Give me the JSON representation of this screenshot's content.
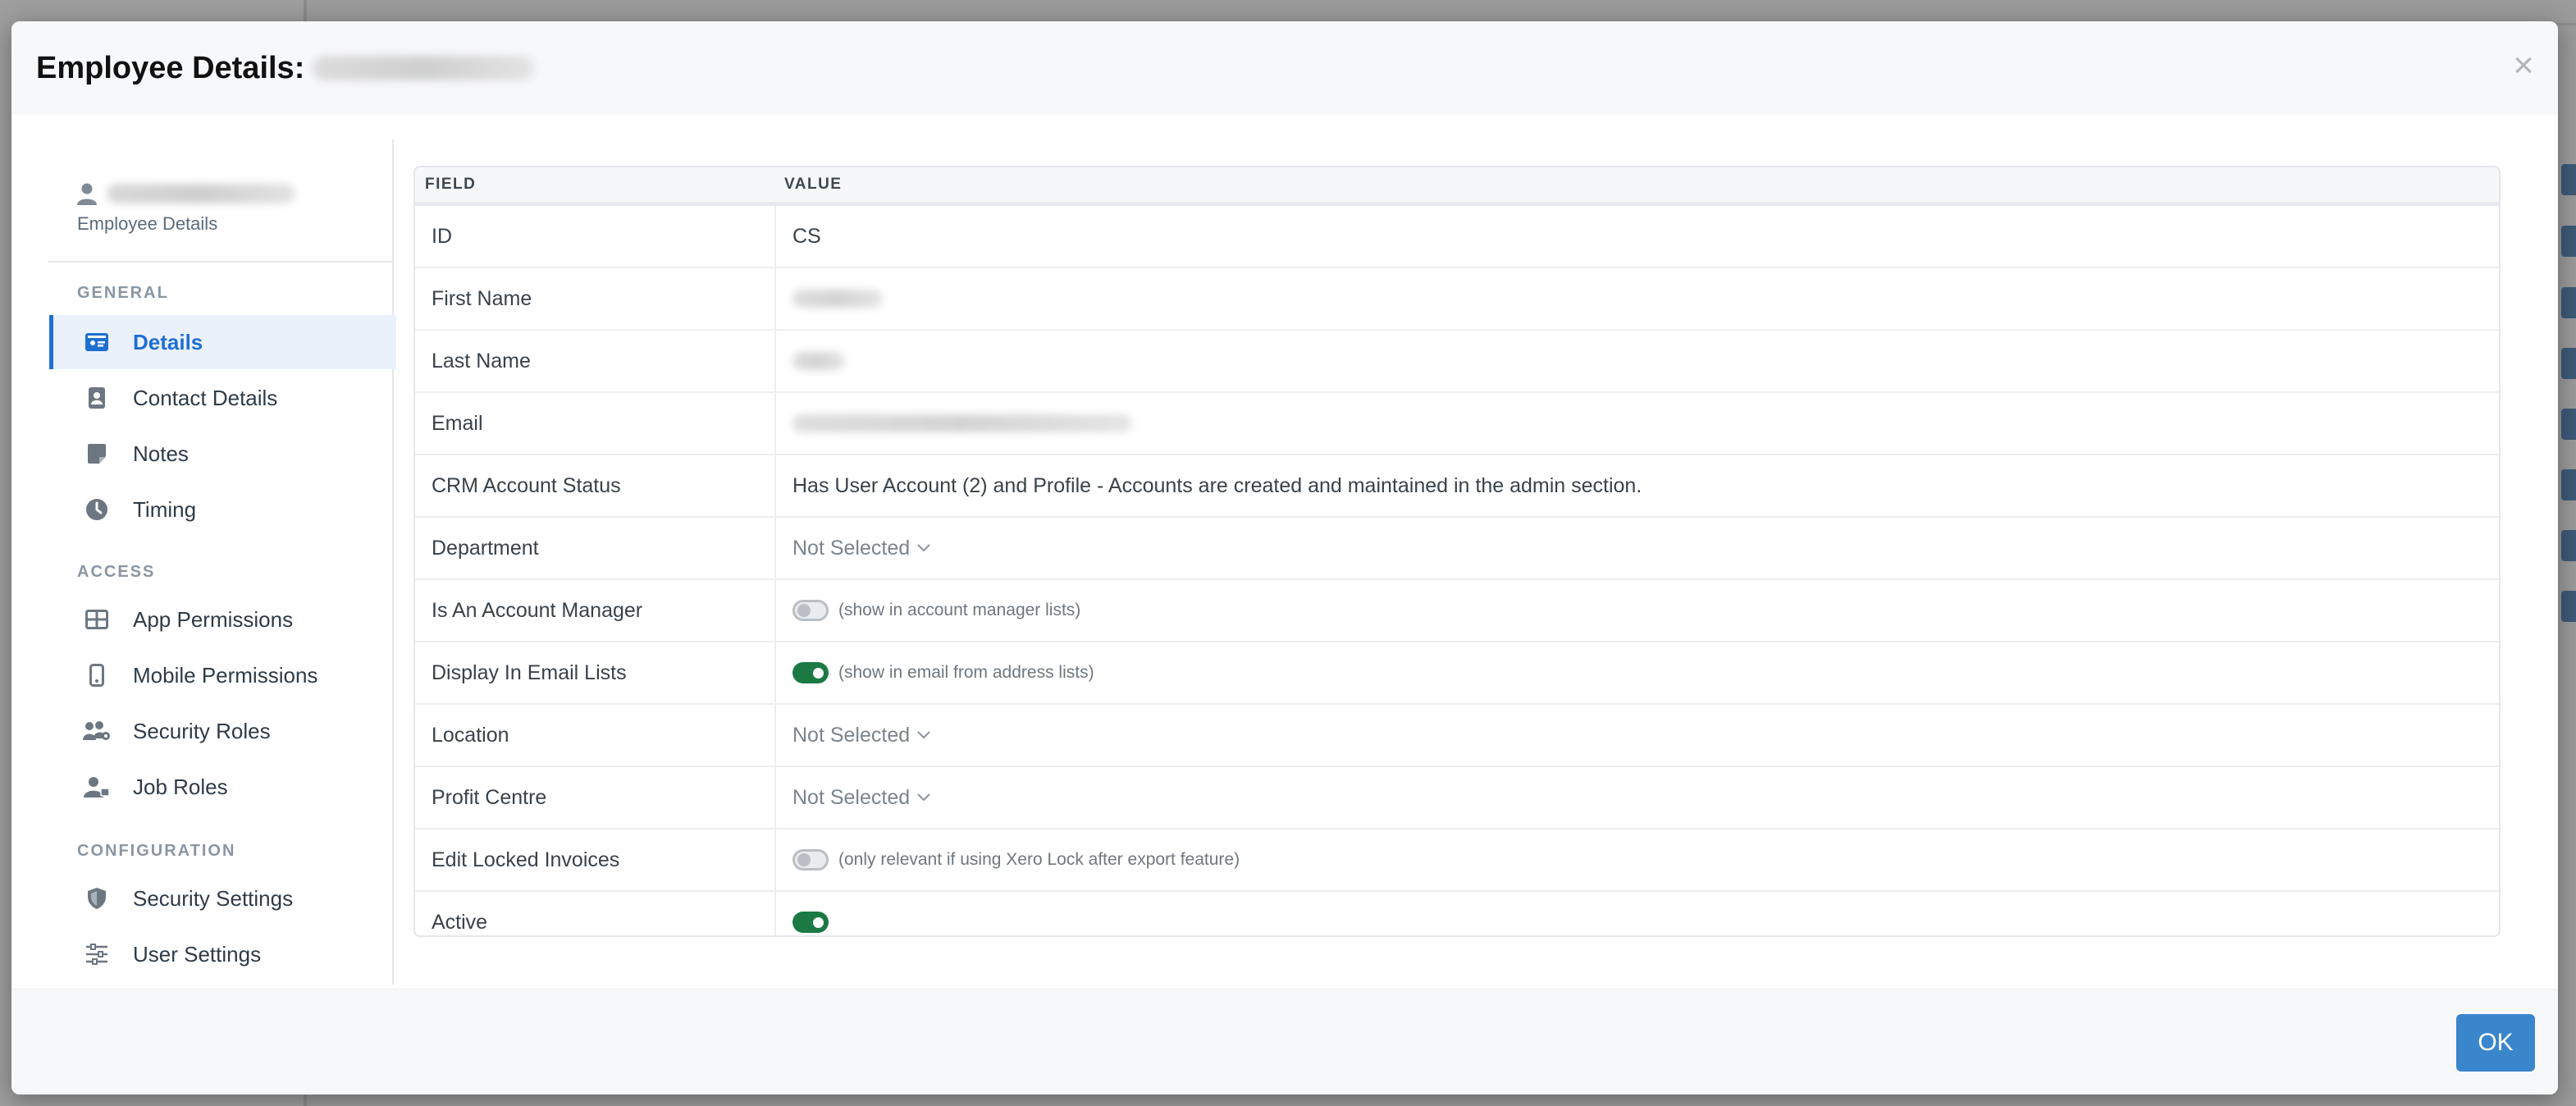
{
  "modal": {
    "title": "Employee Details:",
    "close_icon": "×"
  },
  "sidebar": {
    "user_icon": "user-icon",
    "user_subtitle": "Employee Details",
    "sections": {
      "general": "GENERAL",
      "access": "ACCESS",
      "configuration": "CONFIGURATION"
    },
    "items": [
      {
        "label": "Details",
        "icon": "id-card-icon",
        "active": true
      },
      {
        "label": "Contact Details",
        "icon": "contact-book-icon"
      },
      {
        "label": "Notes",
        "icon": "note-icon"
      },
      {
        "label": "Timing",
        "icon": "clock-icon"
      },
      {
        "label": "App Permissions",
        "icon": "grid-icon"
      },
      {
        "label": "Mobile Permissions",
        "icon": "mobile-icon"
      },
      {
        "label": "Security Roles",
        "icon": "users-group-icon"
      },
      {
        "label": "Job Roles",
        "icon": "user-tie-icon"
      },
      {
        "label": "Security Settings",
        "icon": "shield-icon"
      },
      {
        "label": "User Settings",
        "icon": "sliders-icon"
      }
    ]
  },
  "table": {
    "headers": {
      "field": "FIELD",
      "value": "VALUE"
    },
    "rows": {
      "id": {
        "field": "ID",
        "value": "CS"
      },
      "first_name": {
        "field": "First Name"
      },
      "last_name": {
        "field": "Last Name"
      },
      "email": {
        "field": "Email"
      },
      "crm_status": {
        "field": "CRM Account Status",
        "value": "Has User Account (2) and Profile - Accounts are created and maintained in the admin section."
      },
      "department": {
        "field": "Department",
        "value": "Not Selected"
      },
      "account_manager": {
        "field": "Is An Account Manager",
        "toggle": false,
        "hint": "(show in account manager lists)"
      },
      "email_lists": {
        "field": "Display In Email Lists",
        "toggle": true,
        "hint": "(show in email from address lists)"
      },
      "location": {
        "field": "Location",
        "value": "Not Selected"
      },
      "profit_centre": {
        "field": "Profit Centre",
        "value": "Not Selected"
      },
      "edit_locked": {
        "field": "Edit Locked Invoices",
        "toggle": false,
        "hint": "(only relevant if using Xero Lock after export feature)"
      },
      "active": {
        "field": "Active",
        "toggle": true
      }
    }
  },
  "footer": {
    "ok_label": "OK"
  },
  "colors": {
    "accent": "#1f6fd1",
    "toggle_on": "#1b7a44",
    "ok_button": "#3a86cc"
  }
}
